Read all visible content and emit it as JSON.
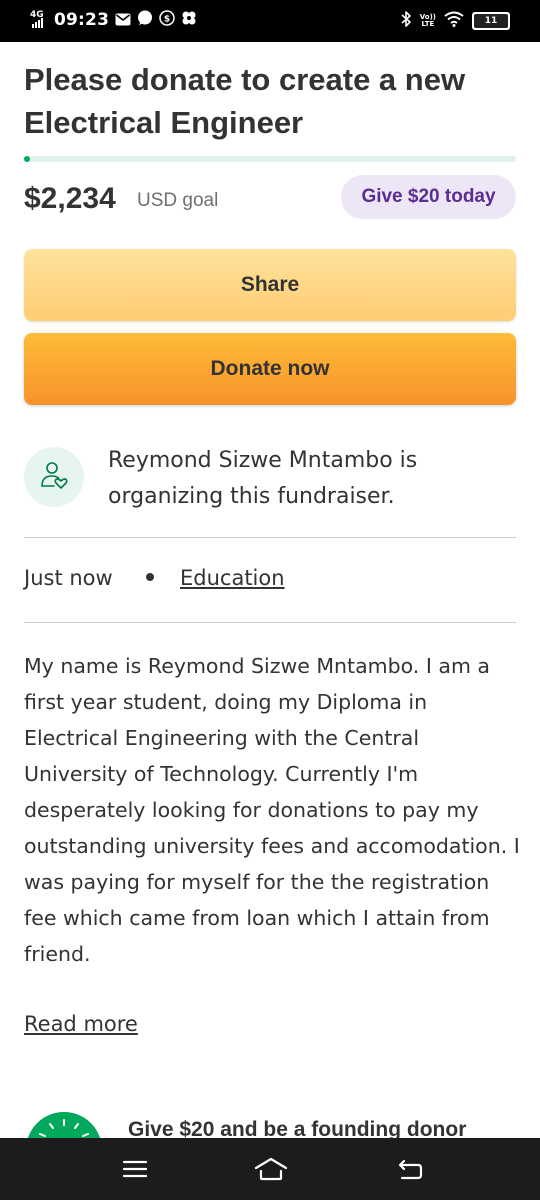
{
  "status_bar": {
    "network": "4G",
    "time": "09:23",
    "left_icons": [
      "mail-icon",
      "chat-icon",
      "dollar-circle-icon",
      "pinwheel-icon"
    ],
    "right_icons": [
      "bluetooth-icon",
      "volte-icon",
      "wifi-icon"
    ],
    "volte_label_top": "Vo))",
    "volte_label_bottom": "LTE",
    "battery": "11"
  },
  "campaign": {
    "title": "Please donate to create a new Electrical Engineer",
    "progress_fraction": 0.005,
    "raised_amount": "$2,234",
    "goal_label": "USD goal",
    "give_pill_label": "Give $20 today",
    "colors": {
      "accent_green": "#02a95c",
      "share_button": "#ffd47f",
      "donate_button": "#fbab34",
      "pill_bg": "#ece6f6",
      "pill_text": "#5b2d8f"
    }
  },
  "actions": {
    "share_label": "Share",
    "donate_label": "Donate now"
  },
  "organizer": {
    "icon": "person-heart-icon",
    "text": "Reymond Sizwe Mntambo is organizing this fundraiser."
  },
  "meta": {
    "time": "Just now",
    "category": "Education"
  },
  "story": {
    "text": "My name is Reymond Sizwe Mntambo. I am a first year student, doing my Diploma in Electrical Engineering with the Central University of Technology. Currently I'm desperately looking for donations to pay my outstanding university fees and accomodation. I was paying for myself for the the registration fee which came from loan which I attain from friend.",
    "read_more_label": "Read more"
  },
  "founding_donor": {
    "icon": "founding-donor-badge-icon",
    "text": "Give $20 and be a founding donor"
  },
  "nav_bar": {
    "buttons": [
      "menu-icon",
      "home-icon",
      "back-icon"
    ]
  }
}
